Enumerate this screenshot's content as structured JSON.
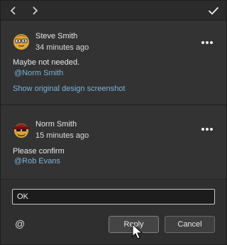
{
  "toolbar": {
    "back_icon": "chevron-left-icon",
    "forward_icon": "chevron-right-icon",
    "resolve_icon": "checkmark-icon"
  },
  "comments": [
    {
      "author": "Steve Smith",
      "time": "34 minutes ago",
      "text": "Maybe not needed.",
      "mention": "@Norm Smith",
      "link": "Show original design screenshot",
      "more_icon": "more-options-icon"
    },
    {
      "author": "Norm Smith",
      "time": "15 minutes ago",
      "text": "Please confirm",
      "mention": "@Rob Evans",
      "more_icon": "more-options-icon"
    }
  ],
  "reply": {
    "value": "OK",
    "mention_icon": "at-sign-icon",
    "reply_label": "Reply",
    "cancel_label": "Cancel"
  }
}
